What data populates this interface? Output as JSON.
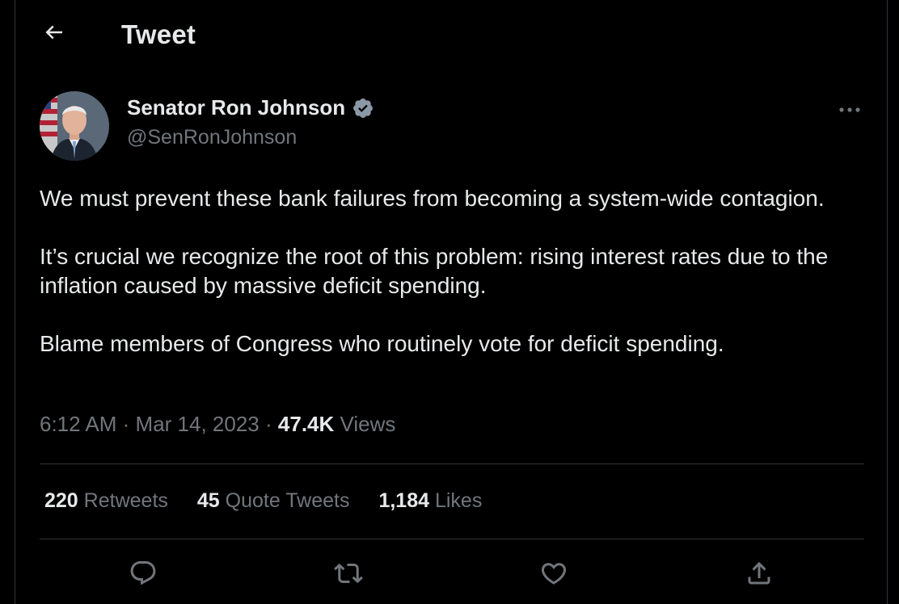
{
  "header": {
    "title": "Tweet",
    "back_icon": "arrow-left-icon"
  },
  "author": {
    "name": "Senator Ron Johnson",
    "handle": "@SenRonJohnson",
    "verified_badge_color": "#8b98a5",
    "avatar_icon": "avatar-photo"
  },
  "tweet": {
    "paragraphs": [
      "We must prevent these bank failures from becoming a system-wide contagion.",
      "It’s crucial we recognize the root of this problem: rising interest rates due to the inflation caused by massive deficit spending.",
      "Blame members of Congress who routinely vote for deficit spending."
    ]
  },
  "meta": {
    "time": "6:12 AM",
    "separator": "·",
    "date": "Mar 14, 2023",
    "views_count": "47.4K",
    "views_label": "Views"
  },
  "stats": {
    "retweets_count": "220",
    "retweets_label": "Retweets",
    "quotes_count": "45",
    "quotes_label": "Quote Tweets",
    "likes_count": "1,184",
    "likes_label": "Likes"
  },
  "actions": [
    "reply-icon",
    "retweet-icon",
    "like-icon",
    "share-icon"
  ],
  "colors": {
    "background": "#000000",
    "text_primary": "#e7e9ea",
    "text_secondary": "#71767b",
    "divider": "#2f3336"
  }
}
